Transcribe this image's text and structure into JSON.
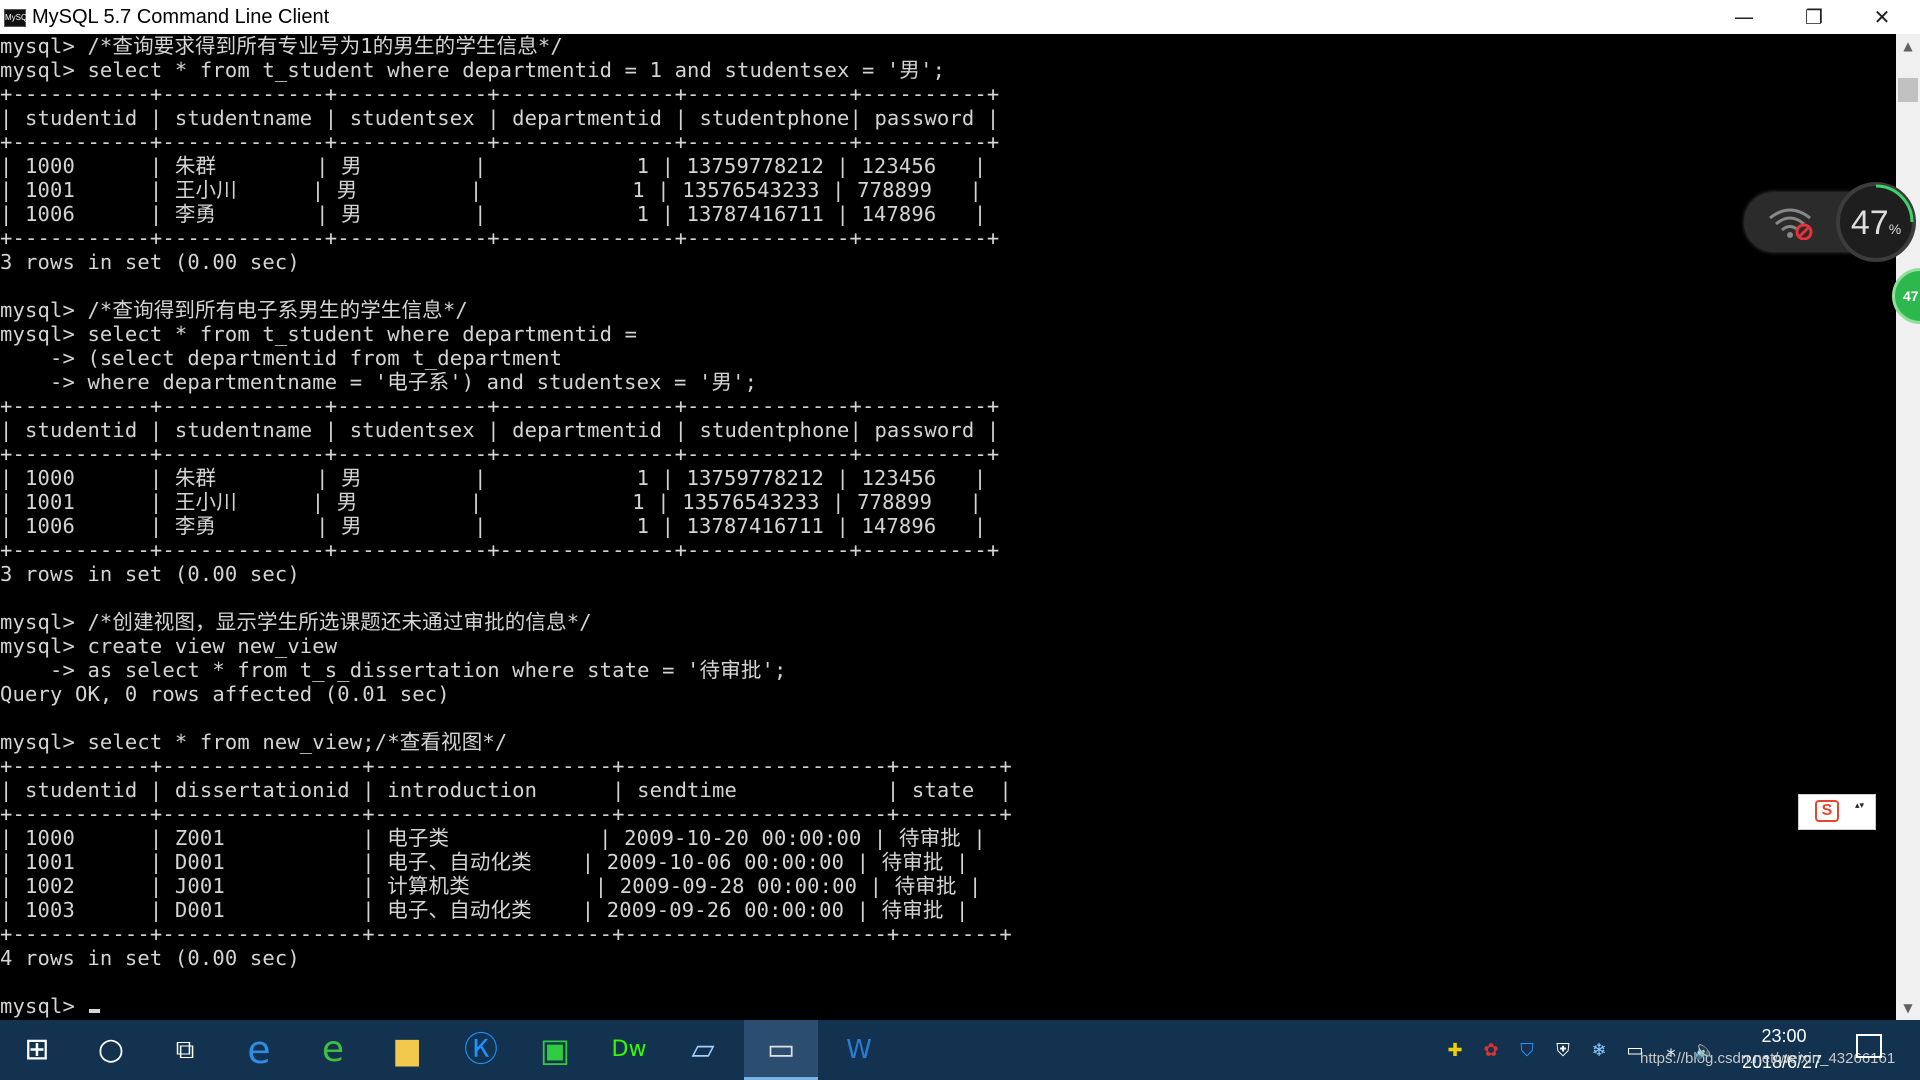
{
  "window": {
    "title": "MySQL 5.7 Command Line Client",
    "icon_label": "MySQL",
    "minimize_glyph": "—",
    "maximize_glyph": "❐",
    "close_glyph": "✕"
  },
  "console": {
    "lines": [
      "mysql> /*查询要求得到所有专业号为1的男生的学生信息*/",
      "mysql> select * from t_student where departmentid = 1 and studentsex = '男';",
      "+-----------+-------------+------------+--------------+-------------+----------+",
      "| studentid | studentname | studentsex | departmentid | studentphone| password |",
      "+-----------+-------------+------------+--------------+-------------+----------+",
      "| 1000      | 朱群        | 男         |            1 | 13759778212 | 123456   |",
      "| 1001      | 王小川      | 男         |            1 | 13576543233 | 778899   |",
      "| 1006      | 李勇        | 男         |            1 | 13787416711 | 147896   |",
      "+-----------+-------------+------------+--------------+-------------+----------+",
      "3 rows in set (0.00 sec)",
      "",
      "mysql> /*查询得到所有电子系男生的学生信息*/",
      "mysql> select * from t_student where departmentid =",
      "    -> (select departmentid from t_department",
      "    -> where departmentname = '电子系') and studentsex = '男';",
      "+-----------+-------------+------------+--------------+-------------+----------+",
      "| studentid | studentname | studentsex | departmentid | studentphone| password |",
      "+-----------+-------------+------------+--------------+-------------+----------+",
      "| 1000      | 朱群        | 男         |            1 | 13759778212 | 123456   |",
      "| 1001      | 王小川      | 男         |            1 | 13576543233 | 778899   |",
      "| 1006      | 李勇        | 男         |            1 | 13787416711 | 147896   |",
      "+-----------+-------------+------------+--------------+-------------+----------+",
      "3 rows in set (0.00 sec)",
      "",
      "mysql> /*创建视图，显示学生所选课题还未通过审批的信息*/",
      "mysql> create view new_view",
      "    -> as select * from t_s_dissertation where state = '待审批';",
      "Query OK, 0 rows affected (0.01 sec)",
      "",
      "mysql> select * from new_view;/*查看视图*/",
      "+-----------+----------------+-------------------+---------------------+--------+",
      "| studentid | dissertationid | introduction      | sendtime            | state  |",
      "+-----------+----------------+-------------------+---------------------+--------+",
      "| 1000      | Z001           | 电子类            | 2009-10-20 00:00:00 | 待审批 |",
      "| 1001      | D001           | 电子、自动化类    | 2009-10-06 00:00:00 | 待审批 |",
      "| 1002      | J001           | 计算机类          | 2009-09-28 00:00:00 | 待审批 |",
      "| 1003      | D001           | 电子、自动化类    | 2009-09-26 00:00:00 | 待审批 |",
      "+-----------+----------------+-------------------+---------------------+--------+",
      "4 rows in set (0.00 sec)",
      "",
      "mysql> "
    ]
  },
  "scrollbar": {
    "up_glyph": "▲",
    "down_glyph": "▼"
  },
  "network_widget": {
    "percent": "47",
    "percent_sign": "%",
    "badge": "47"
  },
  "ime": {
    "logo": "S",
    "arrows": "▴▾"
  },
  "taskbar": {
    "items": [
      {
        "name": "windows-start-icon",
        "glyph": "⊞",
        "color": "#ffffff",
        "size": "30px"
      },
      {
        "name": "cortana-search-icon",
        "glyph": "○",
        "color": "#ffffff",
        "size": "30px"
      },
      {
        "name": "task-view-icon",
        "glyph": "⧉",
        "color": "#ffffff",
        "size": "26px"
      },
      {
        "name": "edge-browser-icon",
        "glyph": "e",
        "color": "#2f8de4",
        "size": "38px"
      },
      {
        "name": "360-browser-icon",
        "glyph": "e",
        "color": "#3fbf3f",
        "size": "36px"
      },
      {
        "name": "file-explorer-icon",
        "glyph": "▆",
        "color": "#f2c94c",
        "size": "30px"
      },
      {
        "name": "kugou-music-icon",
        "glyph": "Ⓚ",
        "color": "#1e90ff",
        "size": "34px"
      },
      {
        "name": "iqiyi-icon",
        "glyph": "▣",
        "color": "#2ecc40",
        "size": "32px"
      },
      {
        "name": "dreamweaver-icon",
        "glyph": "Dw",
        "color": "#35fa00",
        "size": "22px"
      },
      {
        "name": "notepad-icon",
        "glyph": "▱",
        "color": "#a0d0ff",
        "size": "30px"
      },
      {
        "name": "mysql-client-icon",
        "glyph": "▭",
        "color": "#e0e0e0",
        "size": "30px"
      },
      {
        "name": "word-icon",
        "glyph": "W",
        "color": "#2b7cd3",
        "size": "26px"
      }
    ],
    "tray": [
      {
        "name": "tray-add-icon",
        "glyph": "✚",
        "color": "#f0d000"
      },
      {
        "name": "tray-tencent-icon",
        "glyph": "✿",
        "color": "#e03030"
      },
      {
        "name": "tray-shield-icon",
        "glyph": "⛉",
        "color": "#3090ff"
      },
      {
        "name": "tray-security-icon",
        "glyph": "⛨",
        "color": "#ffffff"
      },
      {
        "name": "tray-snowflake-icon",
        "glyph": "❄",
        "color": "#8fd0ff"
      },
      {
        "name": "tray-network-icon",
        "glyph": "▭",
        "color": "#ffffff"
      },
      {
        "name": "tray-wifi-icon",
        "glyph": "⁎",
        "color": "#ffffff"
      },
      {
        "name": "tray-volume-icon",
        "glyph": "🔈",
        "color": "#ffffff"
      }
    ],
    "clock_time": "23:00",
    "clock_date": "2018/6/27",
    "watermark": "https://blog.csdn.net/weixin_43266161"
  }
}
